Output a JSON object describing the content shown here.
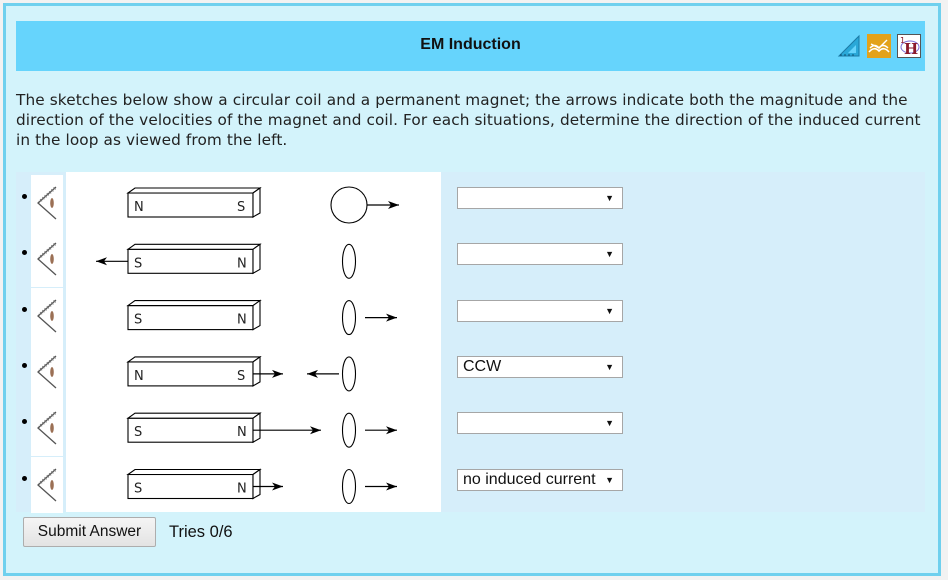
{
  "header": {
    "title": "EM Induction",
    "icons": [
      "triangle-ruler-icon",
      "open-book-icon",
      "periodic-element-icon"
    ]
  },
  "intro": "The sketches below show a circular coil and a permanent magnet; the arrows indicate both the magnitude and the direction of the velocities of the magnet and coil. For each situations, determine the direction of the induced current in the loop as viewed from the left.",
  "rows": [
    {
      "magnet_left": "N",
      "magnet_right": "S",
      "magnet_velocity": "none",
      "coil_velocity": "right",
      "coil_view": "face-on",
      "selected": ""
    },
    {
      "magnet_left": "S",
      "magnet_right": "N",
      "magnet_velocity": "left",
      "coil_velocity": "none",
      "coil_view": "edge-on",
      "selected": ""
    },
    {
      "magnet_left": "S",
      "magnet_right": "N",
      "magnet_velocity": "none",
      "coil_velocity": "right",
      "coil_view": "edge-on",
      "selected": ""
    },
    {
      "magnet_left": "N",
      "magnet_right": "S",
      "magnet_velocity": "right-short",
      "coil_velocity": "left-short",
      "coil_view": "edge-on",
      "selected": "CCW"
    },
    {
      "magnet_left": "S",
      "magnet_right": "N",
      "magnet_velocity": "right-long",
      "coil_velocity": "right",
      "coil_view": "edge-on",
      "selected": ""
    },
    {
      "magnet_left": "S",
      "magnet_right": "N",
      "magnet_velocity": "right-short",
      "coil_velocity": "right",
      "coil_view": "edge-on",
      "selected": "no induced current"
    }
  ],
  "caret": "▼",
  "submit_label": "Submit Answer",
  "tries": "Tries 0/6",
  "colors": {
    "panel_border": "#6fd0ee",
    "panel_bg": "#d3f3fb",
    "header_bg": "#66d4fc"
  }
}
